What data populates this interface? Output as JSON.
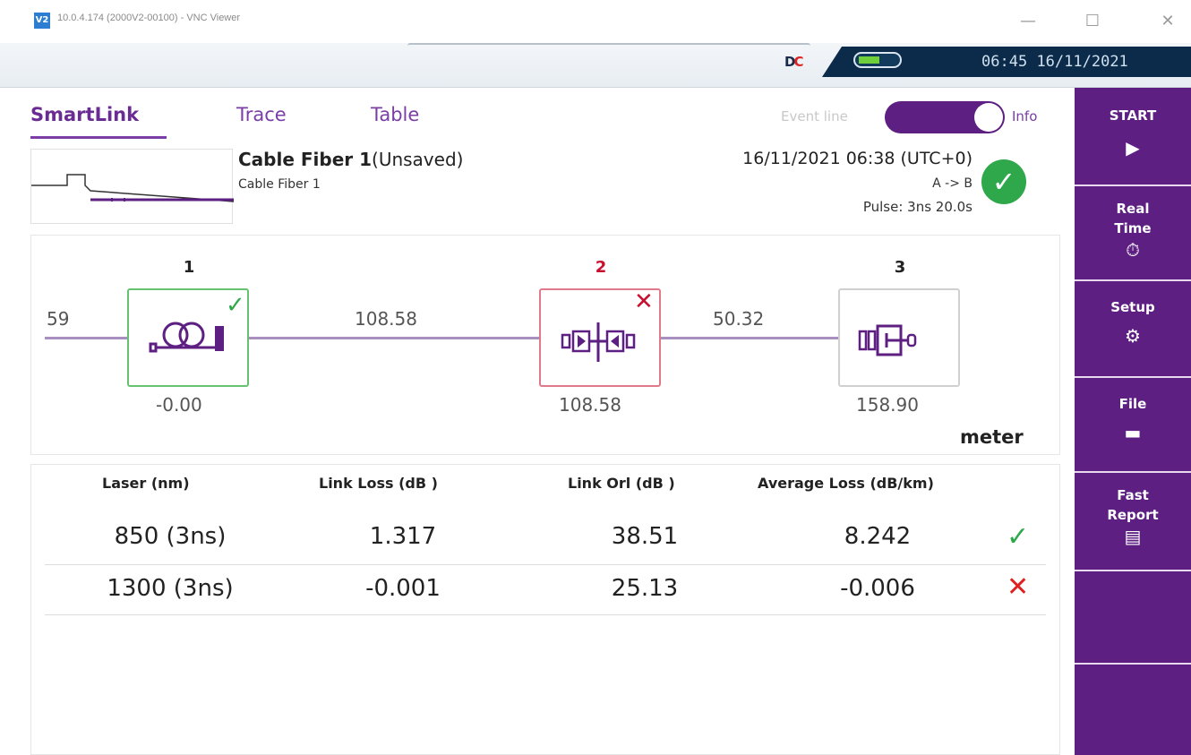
{
  "window": {
    "logo": "V2",
    "title": "10.0.4.174 (2000V2-00100) - VNC Viewer",
    "minimize": "—",
    "maximize": "☐",
    "close": "✕"
  },
  "status": {
    "time": "06:45",
    "date": "16/11/2021",
    "battery_level": 0.5
  },
  "tabs": [
    {
      "label": "SmartLink",
      "active": true
    },
    {
      "label": "Trace",
      "active": false
    },
    {
      "label": "Table",
      "active": false
    }
  ],
  "toggle": {
    "left_label": "Event line",
    "right_label": "Info",
    "state": "Info"
  },
  "measurement": {
    "title": "Cable Fiber 1",
    "title_suffix": "(Unsaved)",
    "subtitle": "Cable Fiber 1",
    "datetime": "16/11/2021 06:38 (UTC+0)",
    "direction": "A -> B",
    "pulse": "Pulse: 3ns  20.0s",
    "status": "pass"
  },
  "link": {
    "left_value": "59",
    "unit": "meter",
    "events": [
      {
        "number": "1",
        "type": "launch-cable-icon",
        "position": "-0.00",
        "status": "pass"
      },
      {
        "number": "2",
        "type": "connector-icon",
        "position": "108.58",
        "status": "fail"
      },
      {
        "number": "3",
        "type": "end-connector-icon",
        "position": "158.90",
        "status": "none"
      }
    ],
    "spans": [
      "108.58",
      "50.32"
    ]
  },
  "results": {
    "headers": [
      "Laser (nm)",
      "Link Loss (dB )",
      "Link Orl (dB )",
      "Average Loss (dB/km)"
    ],
    "rows": [
      {
        "laser": "850 (3ns)",
        "link_loss": "1.317",
        "link_orl": "38.51",
        "avg_loss": "8.242",
        "status": "pass"
      },
      {
        "laser": "1300 (3ns)",
        "link_loss": "-0.001",
        "link_orl": "25.13",
        "avg_loss": "-0.006",
        "status": "fail"
      }
    ]
  },
  "sidebar": {
    "start": {
      "label": "START",
      "icon": "play-icon"
    },
    "realtime": {
      "label": "Real Time",
      "icon": "stopwatch-icon"
    },
    "setup": {
      "label": "Setup",
      "icon": "gear-icon"
    },
    "file": {
      "label": "File",
      "icon": "folder-icon"
    },
    "fast_report": {
      "label": "Fast Report",
      "icon": "report-icon"
    }
  },
  "colors": {
    "accent": "#5d1f82",
    "pass": "#2ea84a",
    "fail": "#e02020"
  }
}
